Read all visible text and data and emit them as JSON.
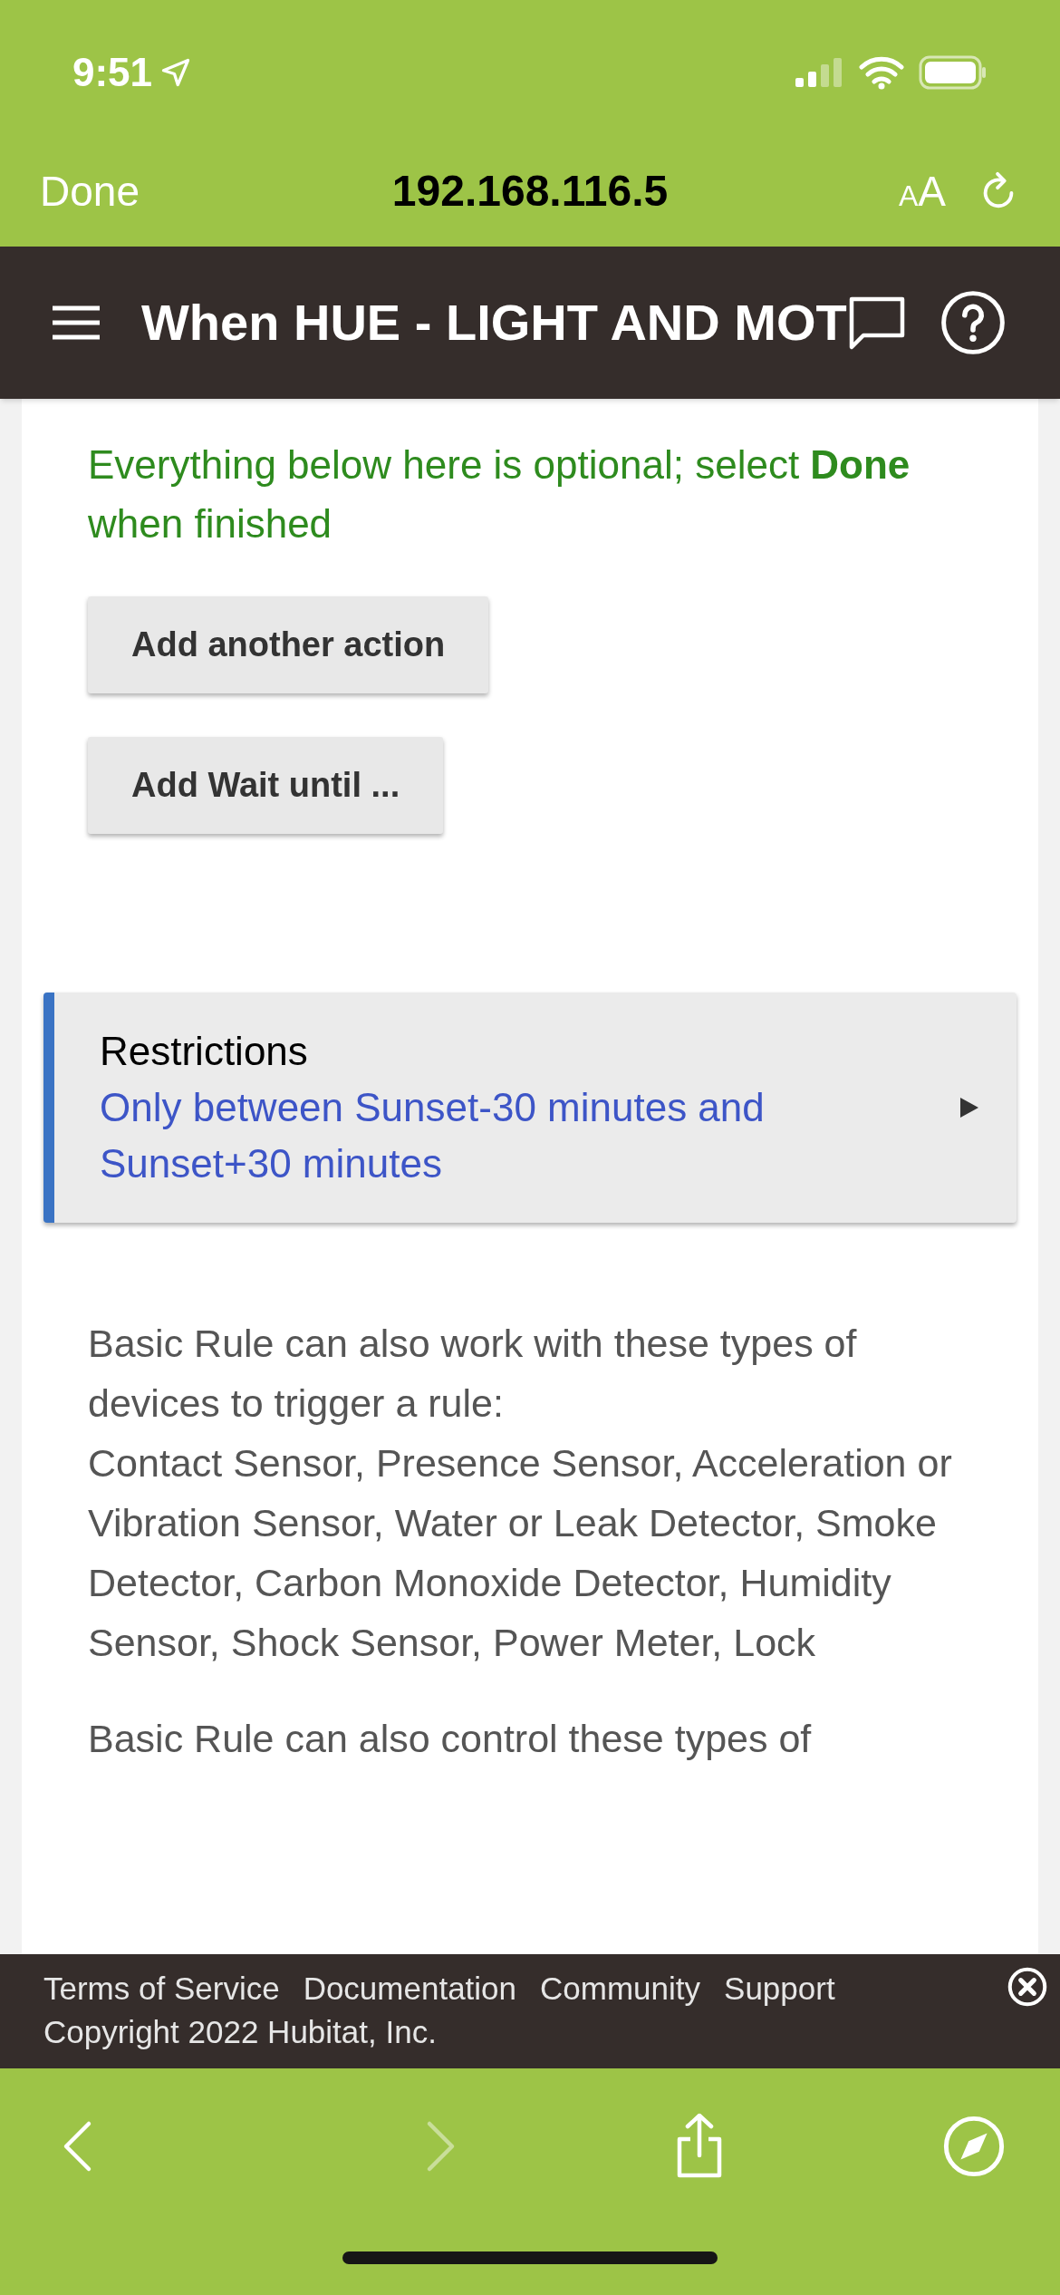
{
  "status_bar": {
    "time": "9:51"
  },
  "browser_bar": {
    "done": "Done",
    "address": "192.168.116.5",
    "text_size": "AA"
  },
  "app_header": {
    "title": "When HUE - LIGHT AND MOT"
  },
  "content": {
    "notice": "Everything below here is optional; select **Done** when finished",
    "buttons": [
      "Add another action",
      "Add Wait until ..."
    ],
    "restrictions": {
      "title": "Restrictions",
      "value": "Only between Sunset-30 minutes and Sunset+30 minutes"
    },
    "paragraphs": [
      "Basic Rule can also work with these types of devices to trigger a rule:\nContact Sensor, Presence Sensor, Acceleration or Vibration Sensor, Water or Leak Detector, Smoke Detector, Carbon Monoxide Detector, Humidity Sensor, Shock Sensor, Power Meter, Lock",
      "Basic Rule can also control these types of"
    ]
  },
  "footer": {
    "links": [
      "Terms of Service",
      "Documentation",
      "Community",
      "Support"
    ],
    "copyright": "Copyright 2022 Hubitat, Inc."
  }
}
